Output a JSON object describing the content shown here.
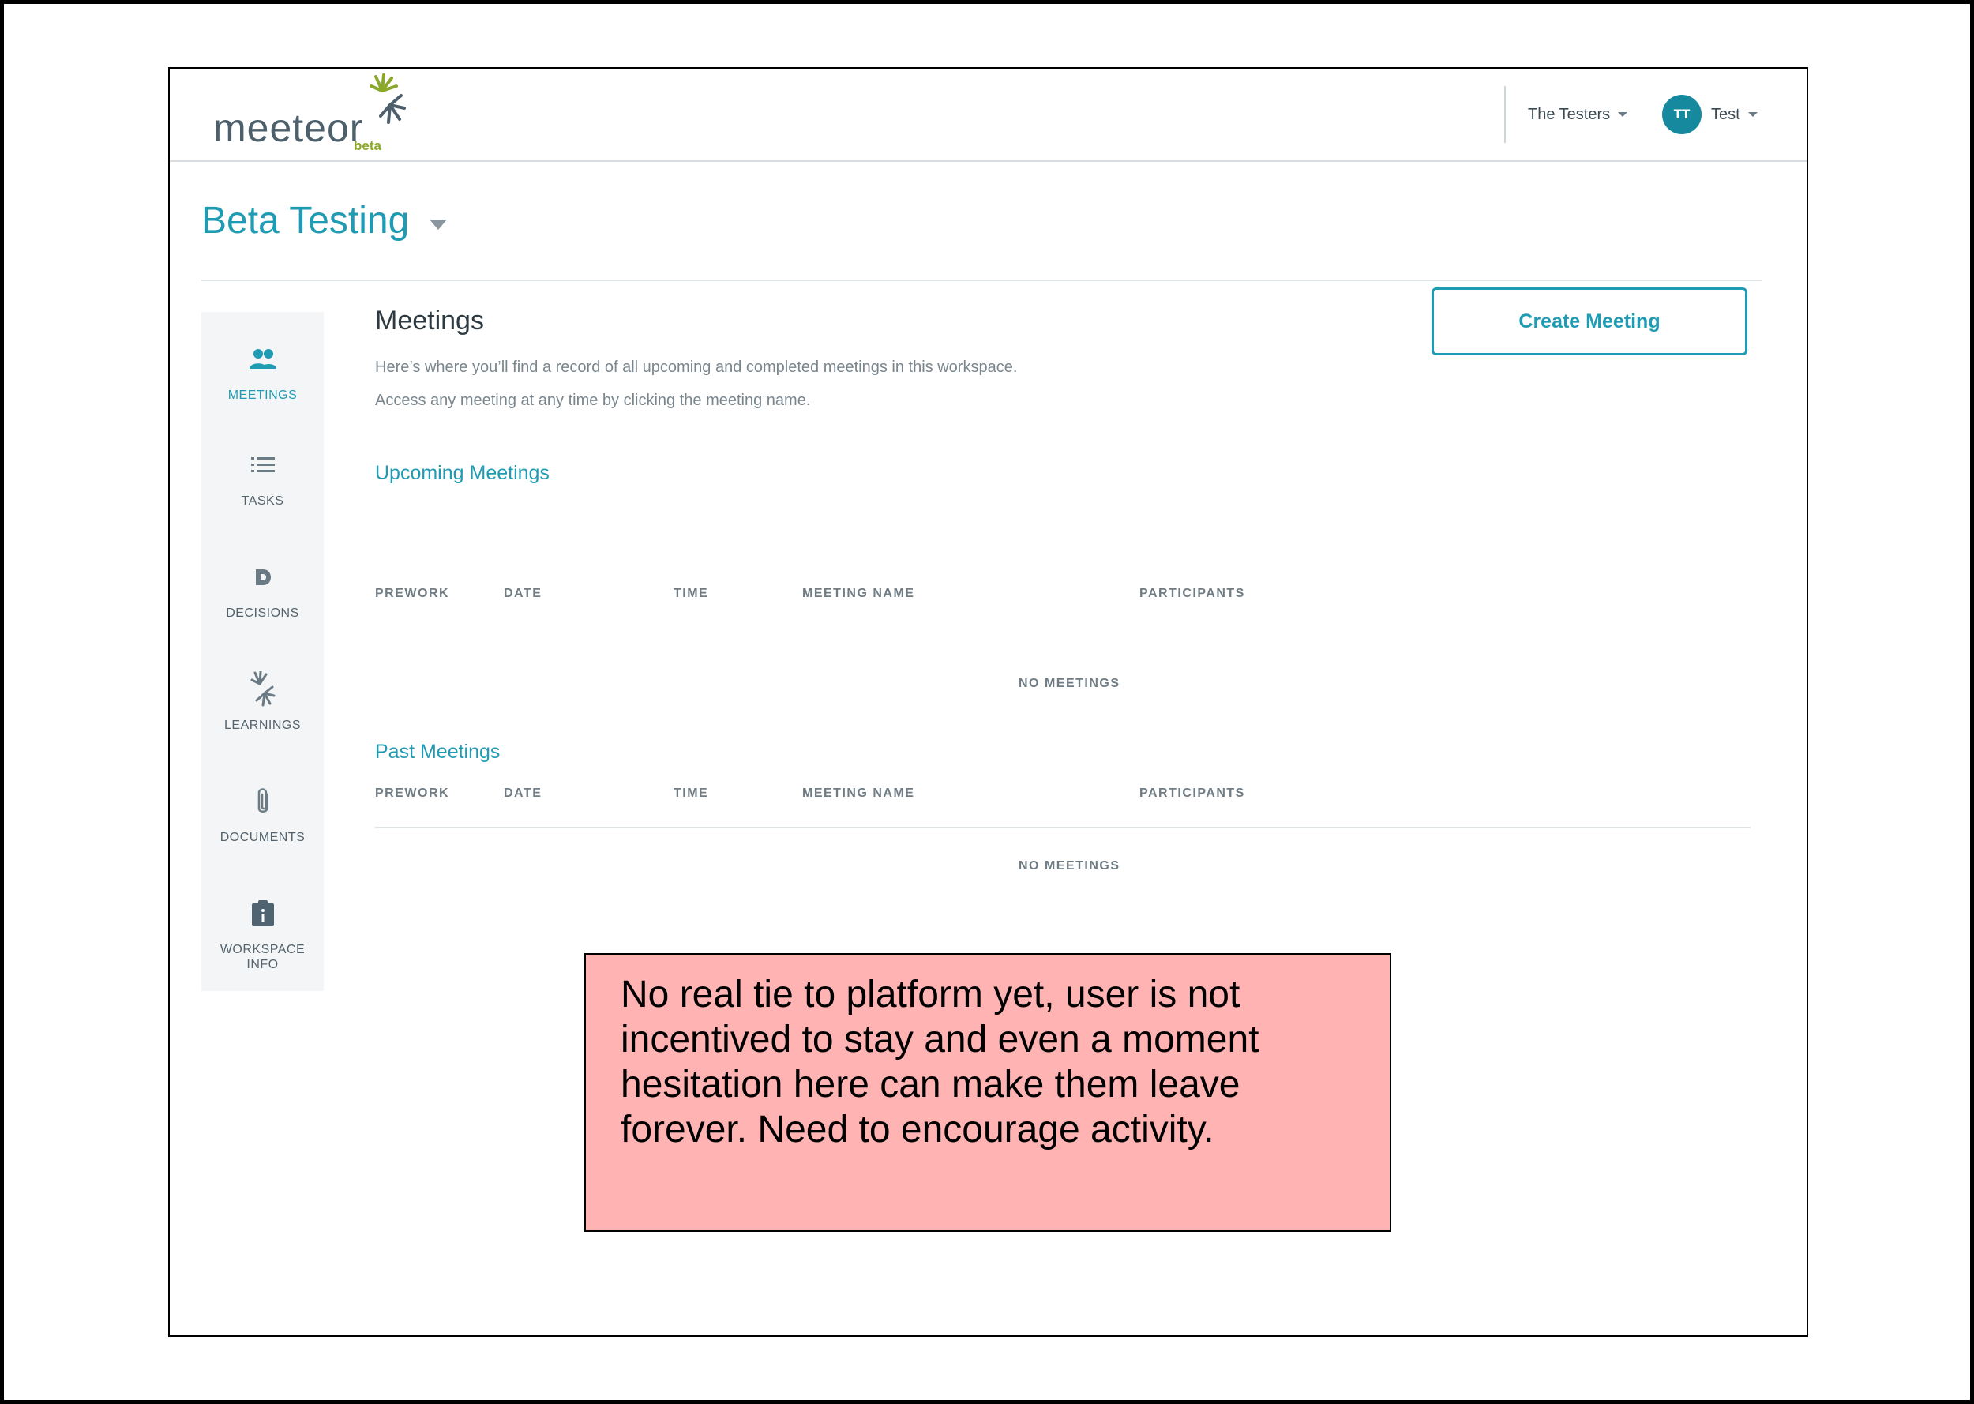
{
  "header": {
    "logo_text": "meeteor",
    "logo_badge": "beta",
    "workspace_switcher": "The Testers",
    "user_initials": "TT",
    "user_name": "Test"
  },
  "page": {
    "title": "Beta Testing"
  },
  "sidebar": {
    "items": [
      {
        "label": "MEETINGS",
        "icon": "people-icon",
        "active": true
      },
      {
        "label": "TASKS",
        "icon": "list-icon"
      },
      {
        "label": "DECISIONS",
        "icon": "decision-d-icon"
      },
      {
        "label": "LEARNINGS",
        "icon": "starburst-icon"
      },
      {
        "label": "DOCUMENTS",
        "icon": "paperclip-icon"
      },
      {
        "label": "WORKSPACE INFO",
        "icon": "info-clipboard-icon"
      }
    ]
  },
  "main": {
    "title": "Meetings",
    "description_1": "Here’s where you’ll find a record of all upcoming and completed meetings in this workspace.",
    "description_2": "Access any meeting at any time by clicking the meeting name.",
    "create_button": "Create Meeting",
    "upcoming": {
      "title": "Upcoming Meetings",
      "columns": [
        "PREWORK",
        "DATE",
        "TIME",
        "MEETING NAME",
        "PARTICIPANTS"
      ],
      "empty_text": "NO MEETINGS"
    },
    "past": {
      "title": "Past Meetings",
      "columns": [
        "PREWORK",
        "DATE",
        "TIME",
        "MEETING NAME",
        "PARTICIPANTS"
      ],
      "empty_text": "NO MEETINGS"
    }
  },
  "note": {
    "text": "No real tie to platform yet, user is not incentived to stay and even a moment hesitation here can make them leave forever. Need to encourage activity."
  },
  "colors": {
    "accent": "#1f9bb3",
    "avatar": "#16899f",
    "note_background": "#ffb3b3",
    "logo_green": "#8aa829"
  }
}
